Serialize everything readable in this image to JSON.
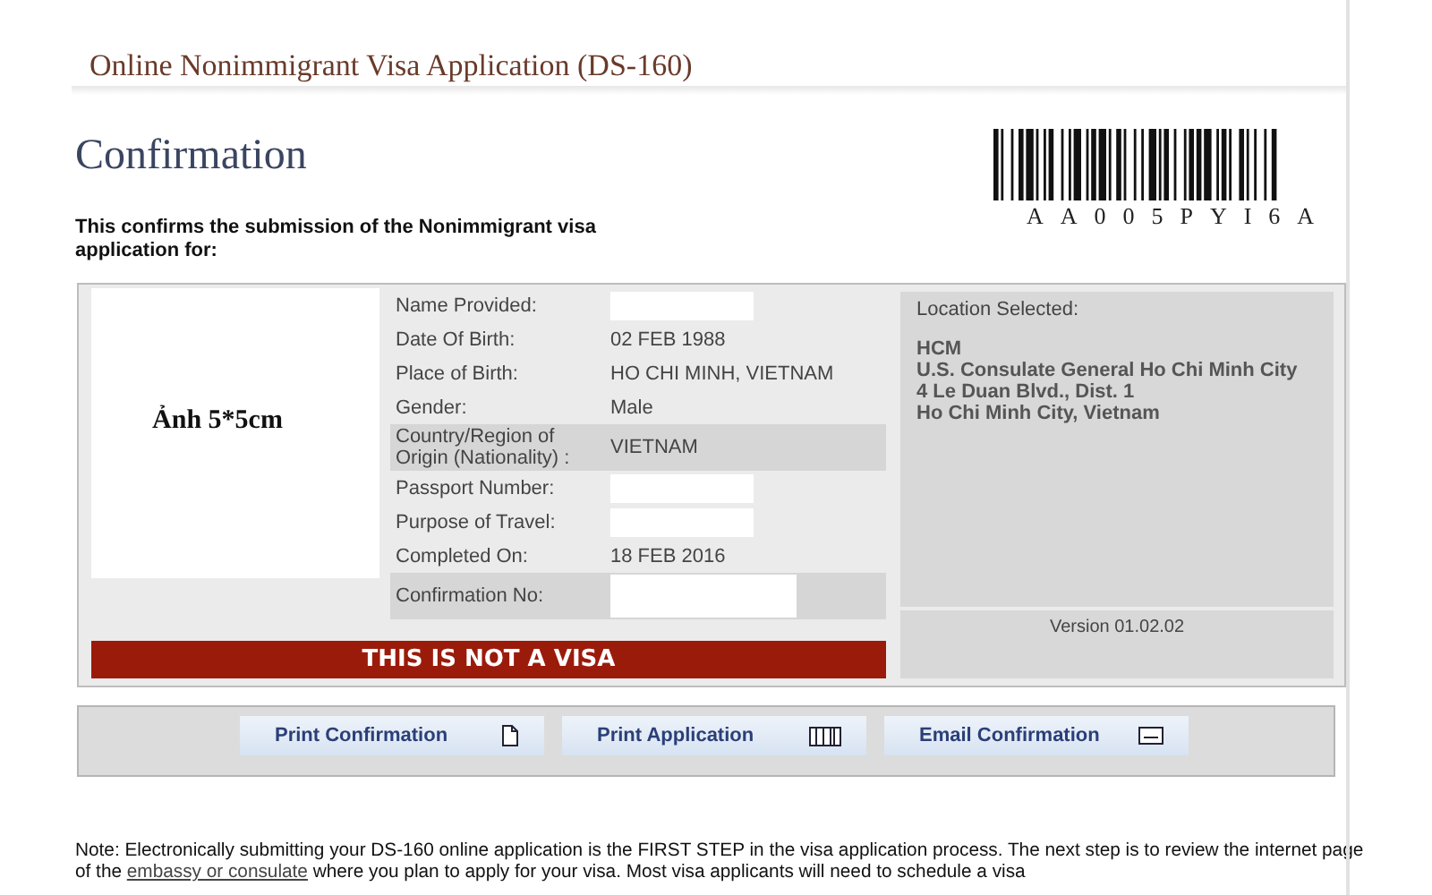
{
  "header": {
    "title": "Online Nonimmigrant Visa Application (DS-160)"
  },
  "page_title": "Confirmation",
  "intro": "This confirms the submission of the Nonimmigrant visa application for:",
  "barcode": {
    "code": "AA005PYI6A"
  },
  "photo": {
    "label": "Ảnh 5*5cm"
  },
  "details": [
    {
      "label": "Name Provided:",
      "kind": "blank",
      "highlighted": false
    },
    {
      "label": "Date Of Birth:",
      "kind": "text",
      "value": "02 FEB 1988",
      "highlighted": false
    },
    {
      "label": "Place of Birth:",
      "kind": "text",
      "value": "HO CHI MINH, VIETNAM",
      "highlighted": false
    },
    {
      "label": "Gender:",
      "kind": "text",
      "value": "Male",
      "highlighted": false
    },
    {
      "label": "Country/Region of Origin (Nationality) :",
      "kind": "text",
      "value": "VIETNAM",
      "highlighted": true
    },
    {
      "label": "Passport Number:",
      "kind": "blank",
      "highlighted": false
    },
    {
      "label": "Purpose of Travel:",
      "kind": "blank",
      "highlighted": false
    },
    {
      "label": "Completed On:",
      "kind": "text",
      "value": "18 FEB 2016",
      "highlighted": false
    },
    {
      "label": "Confirmation No:",
      "kind": "blank",
      "highlighted": true
    }
  ],
  "location": {
    "heading": "Location Selected:",
    "lines": [
      "HCM",
      "U.S. Consulate General Ho Chi Minh City",
      "4 Le Duan Blvd., Dist. 1",
      "Ho Chi Minh City, Vietnam"
    ]
  },
  "version": "Version 01.02.02",
  "banner": "THIS IS NOT A VISA",
  "buttons": [
    {
      "label": "Print Confirmation",
      "kind": "document"
    },
    {
      "label": "Print Application",
      "kind": "pages"
    },
    {
      "label": "Email Confirmation",
      "kind": "envelope"
    }
  ],
  "note": {
    "before": "Note: Electronically submitting your DS-160 online application is the FIRST STEP in the visa application process. The next step is to review the internet page of the",
    "link": "embassy or consulate",
    "after": "where you plan to apply for your visa. Most visa applicants will need to schedule a visa"
  }
}
